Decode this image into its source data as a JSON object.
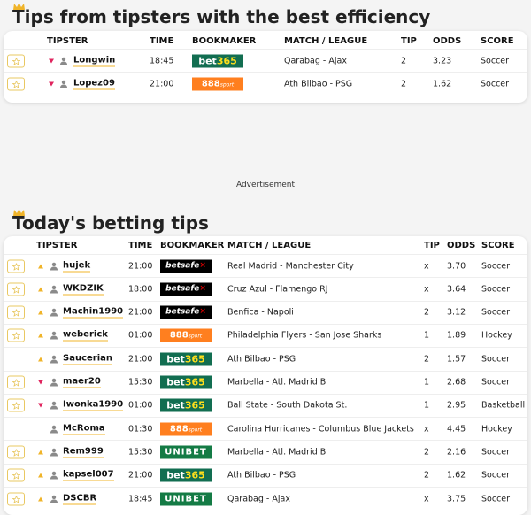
{
  "sections": {
    "efficiency": {
      "title": "Tips from tipsters with the best efficiency",
      "headers": {
        "tipster": "TIPSTER",
        "time": "TIME",
        "bookmaker": "BOOKMAKER",
        "match": "MATCH / LEAGUE",
        "tip": "TIP",
        "odds": "ODDS",
        "score": "SCORE"
      },
      "rows": [
        {
          "fav": true,
          "trend": "down",
          "tipster": "Longwin",
          "time": "18:45",
          "bookmaker": "bet365",
          "match": "Qarabag - Ajax",
          "tip": "2",
          "odds": "3.23",
          "sport": "Soccer"
        },
        {
          "fav": true,
          "trend": "down",
          "tipster": "Lopez09",
          "time": "21:00",
          "bookmaker": "888sport",
          "match": "Ath Bilbao - PSG",
          "tip": "2",
          "odds": "1.62",
          "sport": "Soccer"
        }
      ]
    },
    "advertisement": "Advertisement",
    "today": {
      "title": "Today's betting tips",
      "headers": {
        "tipster": "TIPSTER",
        "time": "TIME",
        "bookmaker": "BOOKMAKER",
        "match": "MATCH / LEAGUE",
        "tip": "TIP",
        "odds": "ODDS",
        "score": "SCORE"
      },
      "rows": [
        {
          "fav": true,
          "trend": "up",
          "tipster": "hujek",
          "time": "21:00",
          "bookmaker": "betsafe",
          "match": "Real Madrid - Manchester City",
          "tip": "x",
          "odds": "3.70",
          "sport": "Soccer"
        },
        {
          "fav": true,
          "trend": "up",
          "tipster": "WKDZIK",
          "time": "18:00",
          "bookmaker": "betsafe",
          "match": "Cruz Azul - Flamengo RJ",
          "tip": "x",
          "odds": "3.64",
          "sport": "Soccer"
        },
        {
          "fav": true,
          "trend": "up",
          "tipster": "Machin1990",
          "time": "21:00",
          "bookmaker": "betsafe",
          "match": "Benfica - Napoli",
          "tip": "2",
          "odds": "3.12",
          "sport": "Soccer"
        },
        {
          "fav": true,
          "trend": "up",
          "tipster": "weberick",
          "time": "01:00",
          "bookmaker": "888sport",
          "match": "Philadelphia Flyers - San Jose Sharks",
          "tip": "1",
          "odds": "1.89",
          "sport": "Hockey"
        },
        {
          "fav": false,
          "trend": "up",
          "tipster": "Saucerian",
          "time": "21:00",
          "bookmaker": "bet365",
          "match": "Ath Bilbao - PSG",
          "tip": "2",
          "odds": "1.57",
          "sport": "Soccer"
        },
        {
          "fav": true,
          "trend": "down",
          "tipster": "maer20",
          "time": "15:30",
          "bookmaker": "bet365",
          "match": "Marbella - Atl. Madrid B",
          "tip": "1",
          "odds": "2.68",
          "sport": "Soccer"
        },
        {
          "fav": true,
          "trend": "down",
          "tipster": "Iwonka1990",
          "time": "01:00",
          "bookmaker": "bet365",
          "match": "Ball State - South Dakota St.",
          "tip": "1",
          "odds": "2.95",
          "sport": "Basketball"
        },
        {
          "fav": false,
          "trend": "none",
          "tipster": "McRoma",
          "time": "01:30",
          "bookmaker": "888sport",
          "match": "Carolina Hurricanes - Columbus Blue Jackets",
          "tip": "x",
          "odds": "4.45",
          "sport": "Hockey"
        },
        {
          "fav": true,
          "trend": "up",
          "tipster": "Rem999",
          "time": "15:30",
          "bookmaker": "unibet",
          "match": "Marbella - Atl. Madrid B",
          "tip": "2",
          "odds": "2.16",
          "sport": "Soccer"
        },
        {
          "fav": true,
          "trend": "up",
          "tipster": "kapsel007",
          "time": "21:00",
          "bookmaker": "bet365",
          "match": "Ath Bilbao - PSG",
          "tip": "2",
          "odds": "1.62",
          "sport": "Soccer"
        },
        {
          "fav": true,
          "trend": "up",
          "tipster": "DSCBR",
          "time": "18:45",
          "bookmaker": "unibet",
          "match": "Qarabag - Ajax",
          "tip": "x",
          "odds": "3.75",
          "sport": "Soccer"
        }
      ]
    }
  },
  "colors": {
    "accent": "#f0b429",
    "trend_up": "#f0b429",
    "trend_down": "#e0245e",
    "bet365": "#126e51",
    "888sport": "#ff7f1f",
    "betsafe": "#000000",
    "unibet": "#147b45"
  },
  "icons": {
    "crown": "crown-icon",
    "favorite": "star-icon",
    "user": "user-icon",
    "trend_up": "arrow-up-icon",
    "trend_down": "arrow-down-icon"
  }
}
